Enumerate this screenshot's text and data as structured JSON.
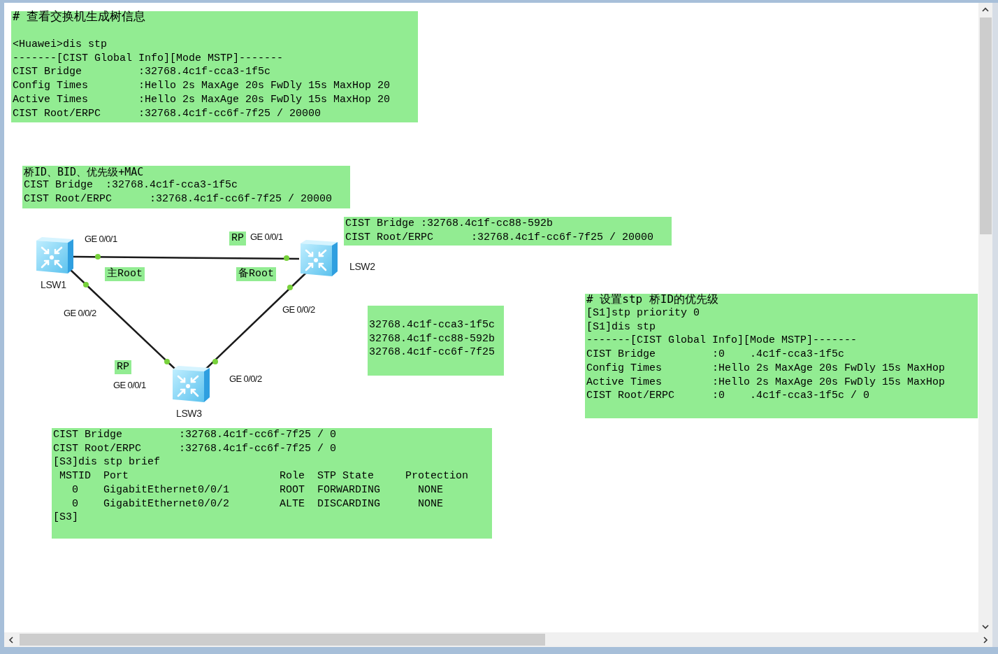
{
  "canvas": {
    "notes": [
      {
        "heading": "# 查看交换机生成树信息",
        "lines": [
          "<Huawei>dis stp",
          "-------[CIST Global Info][Mode MSTP]-------",
          "CIST Bridge         :32768.4c1f-cca3-1f5c",
          "Config Times        :Hello 2s MaxAge 20s FwDly 15s MaxHop 20",
          "Active Times        :Hello 2s MaxAge 20s FwDly 15s MaxHop 20",
          "CIST Root/ERPC      :32768.4c1f-cc6f-7f25 / 20000"
        ]
      },
      {
        "heading": "桥ID、BID、优先级+MAC",
        "lines": [
          "CIST Bridge  :32768.4c1f-cca3-1f5c",
          "CIST Root/ERPC      :32768.4c1f-cc6f-7f25 / 20000"
        ]
      },
      {
        "lines": [
          "CIST Bridge :32768.4c1f-cc88-592b",
          "CIST Root/ERPC      :32768.4c1f-cc6f-7f25 / 20000"
        ]
      },
      {
        "lines": [
          "32768.4c1f-cca3-1f5c",
          "32768.4c1f-cc88-592b",
          "32768.4c1f-cc6f-7f25"
        ]
      },
      {
        "heading": "# 设置stp 桥ID的优先级",
        "lines": [
          "[S1]stp priority 0",
          "[S1]dis stp",
          "-------[CIST Global Info][Mode MSTP]-------",
          "CIST Bridge         :0    .4c1f-cca3-1f5c",
          "Config Times        :Hello 2s MaxAge 20s FwDly 15s MaxHop",
          "Active Times        :Hello 2s MaxAge 20s FwDly 15s MaxHop",
          "CIST Root/ERPC      :0    .4c1f-cca3-1f5c / 0"
        ]
      },
      {
        "lines": [
          "CIST Bridge         :32768.4c1f-cc6f-7f25 / 0",
          "CIST Root/ERPC      :32768.4c1f-cc6f-7f25 / 0",
          "[S3]dis stp brief",
          " MSTID  Port                        Role  STP State     Protection",
          "   0    GigabitEthernet0/0/1        ROOT  FORWARDING      NONE",
          "   0    GigabitEthernet0/0/2        ALTE  DISCARDING      NONE",
          "[S3]"
        ]
      }
    ],
    "devices": [
      {
        "label": "LSW1"
      },
      {
        "label": "LSW2"
      },
      {
        "label": "LSW3"
      }
    ],
    "labels": [
      {
        "kind": "port",
        "text": "GE 0/0/1"
      },
      {
        "kind": "tag",
        "text": "RP"
      },
      {
        "kind": "port",
        "text": "GE 0/0/1"
      },
      {
        "kind": "tag",
        "text": "主Root"
      },
      {
        "kind": "tag",
        "text": "备Root"
      },
      {
        "kind": "port",
        "text": "GE 0/0/2"
      },
      {
        "kind": "port",
        "text": "GE 0/0/2"
      },
      {
        "kind": "tag",
        "text": "RP"
      },
      {
        "kind": "port",
        "text": "GE 0/0/1"
      },
      {
        "kind": "port",
        "text": "GE 0/0/2"
      }
    ]
  }
}
